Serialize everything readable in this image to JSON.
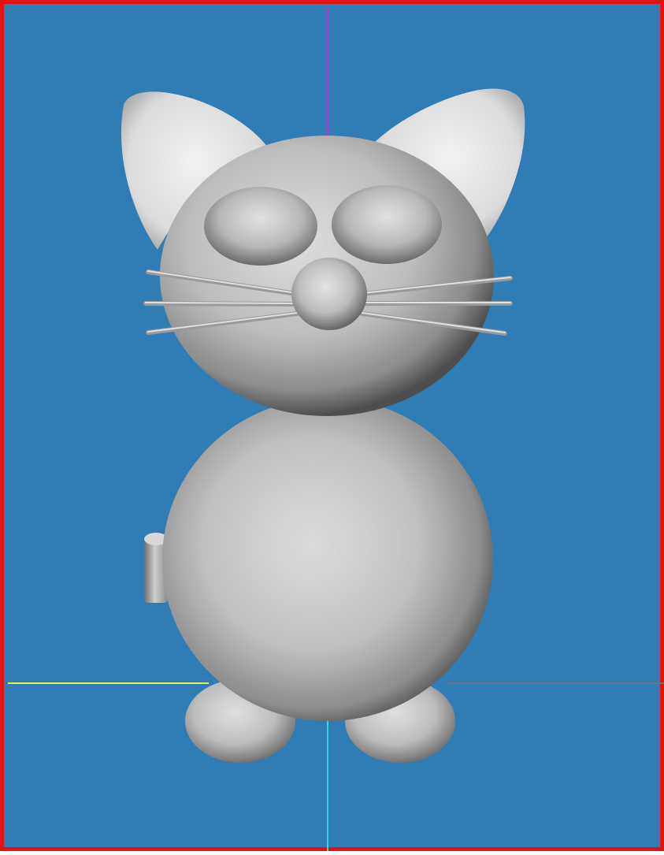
{
  "viewport": {
    "background_color": "#2f7db4",
    "border_color": "#e31313",
    "model_color": "#b9b9b9"
  },
  "axes": {
    "x_axis_color": "#e8f25a",
    "y_axis_color": "#9b3fd1",
    "z_axis_color": "#34d6e6",
    "negative_axis_color": "#6a6f8c"
  },
  "model": {
    "subject": "cat",
    "parts": [
      "ear-left",
      "ear-right",
      "head",
      "eye-left",
      "eye-right",
      "nose",
      "whiskers",
      "body",
      "tail",
      "foot-left",
      "foot-right"
    ]
  }
}
